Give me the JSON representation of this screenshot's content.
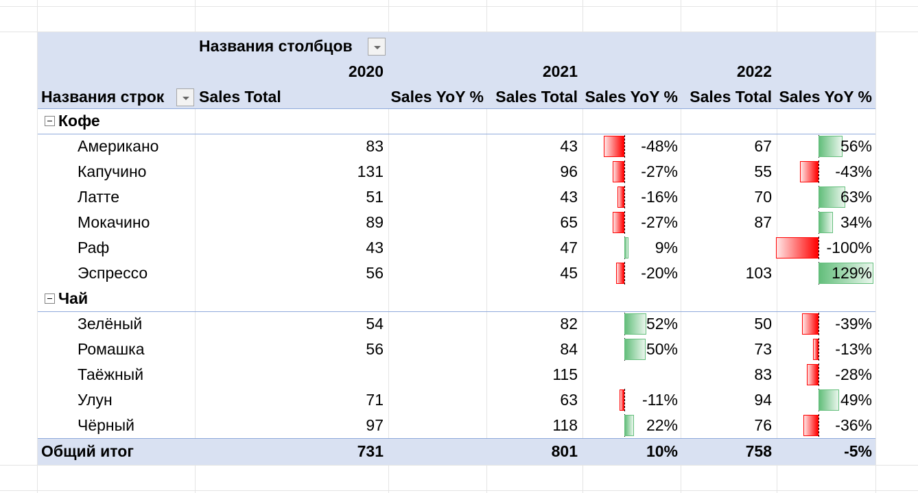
{
  "pivot": {
    "columns_header": "Названия столбцов",
    "rows_header": "Названия строк",
    "years": [
      "2020",
      "2021",
      "2022"
    ],
    "measures": {
      "sales_total": "Sales Total",
      "sales_yoy": "Sales YoY %"
    },
    "groups": [
      {
        "name": "Кофе",
        "rows": [
          {
            "label": "Американо",
            "s2020": "83",
            "y2020": "",
            "s2021": "43",
            "y2021": "-48%",
            "s2022": "67",
            "y2022": "56%",
            "v2021": -0.48,
            "v2022": 0.56
          },
          {
            "label": "Капучино",
            "s2020": "131",
            "y2020": "",
            "s2021": "96",
            "y2021": "-27%",
            "s2022": "55",
            "y2022": "-43%",
            "v2021": -0.27,
            "v2022": -0.43
          },
          {
            "label": "Латте",
            "s2020": "51",
            "y2020": "",
            "s2021": "43",
            "y2021": "-16%",
            "s2022": "70",
            "y2022": "63%",
            "v2021": -0.16,
            "v2022": 0.63
          },
          {
            "label": "Мокачино",
            "s2020": "89",
            "y2020": "",
            "s2021": "65",
            "y2021": "-27%",
            "s2022": "87",
            "y2022": "34%",
            "v2021": -0.27,
            "v2022": 0.34
          },
          {
            "label": "Раф",
            "s2020": "43",
            "y2020": "",
            "s2021": "47",
            "y2021": "9%",
            "s2022": "",
            "y2022": "-100%",
            "v2021": 0.09,
            "v2022": -1.0
          },
          {
            "label": "Эспрессо",
            "s2020": "56",
            "y2020": "",
            "s2021": "45",
            "y2021": "-20%",
            "s2022": "103",
            "y2022": "129%",
            "v2021": -0.2,
            "v2022": 1.29
          }
        ]
      },
      {
        "name": "Чай",
        "rows": [
          {
            "label": "Зелёный",
            "s2020": "54",
            "y2020": "",
            "s2021": "82",
            "y2021": "52%",
            "s2022": "50",
            "y2022": "-39%",
            "v2021": 0.52,
            "v2022": -0.39
          },
          {
            "label": "Ромашка",
            "s2020": "56",
            "y2020": "",
            "s2021": "84",
            "y2021": "50%",
            "s2022": "73",
            "y2022": "-13%",
            "v2021": 0.5,
            "v2022": -0.13
          },
          {
            "label": "Таёжный",
            "s2020": "",
            "y2020": "",
            "s2021": "115",
            "y2021": "",
            "s2022": "83",
            "y2022": "-28%",
            "v2021": null,
            "v2022": -0.28
          },
          {
            "label": "Улун",
            "s2020": "71",
            "y2020": "",
            "s2021": "63",
            "y2021": "-11%",
            "s2022": "94",
            "y2022": "49%",
            "v2021": -0.11,
            "v2022": 0.49
          },
          {
            "label": "Чёрный",
            "s2020": "97",
            "y2020": "",
            "s2021": "118",
            "y2021": "22%",
            "s2022": "76",
            "y2022": "-36%",
            "v2021": 0.22,
            "v2022": -0.36
          }
        ]
      }
    ],
    "total": {
      "label": "Общий итог",
      "s2020": "731",
      "y2020": "",
      "s2021": "801",
      "y2021": "10%",
      "s2022": "758",
      "y2022": "-5%"
    },
    "bar_colors": {
      "negative": "#ff0000",
      "positive": "#63be7b"
    }
  }
}
